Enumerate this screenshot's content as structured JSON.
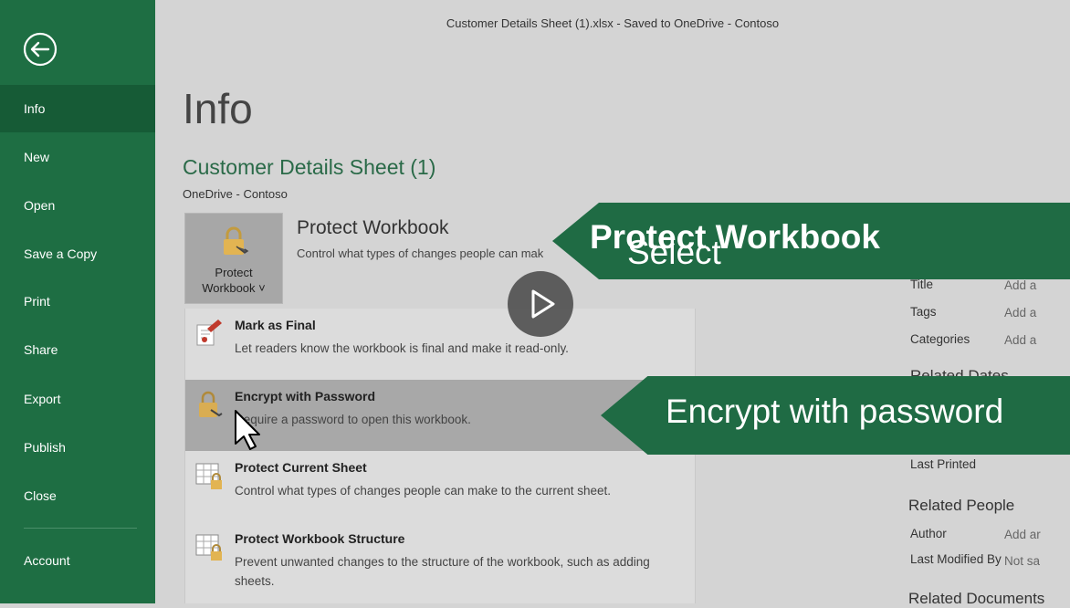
{
  "window": {
    "title": "Customer Details Sheet (1).xlsx  -  Saved to OneDrive - Contoso"
  },
  "sidebar": {
    "items": [
      {
        "label": "Info",
        "active": true
      },
      {
        "label": "New"
      },
      {
        "label": "Open"
      },
      {
        "label": "Save a Copy"
      },
      {
        "label": "Print"
      },
      {
        "label": "Share"
      },
      {
        "label": "Export"
      },
      {
        "label": "Publish"
      },
      {
        "label": "Close"
      },
      {
        "label": "Account"
      }
    ]
  },
  "page": {
    "title": "Info",
    "file_name": "Customer Details Sheet (1)",
    "file_location": "OneDrive - Contoso"
  },
  "protect": {
    "button_line1": "Protect",
    "button_line2": "Workbook ˅",
    "heading": "Protect Workbook",
    "description": "Control what types of changes people can make to this workbook."
  },
  "menu": {
    "items": [
      {
        "title": "Mark as Final",
        "desc": "Let readers know the workbook is final and make it read-only."
      },
      {
        "title": "Encrypt with Password",
        "desc": "Require a password to open this workbook.",
        "highlighted": true
      },
      {
        "title": "Protect Current Sheet",
        "desc": "Control what types of changes people can make to the current sheet."
      },
      {
        "title": "Protect Workbook Structure",
        "desc": "Prevent unwanted changes to the structure of the workbook, such as adding sheets."
      }
    ]
  },
  "properties": {
    "title_label": "Title",
    "title_value": "Add a",
    "tags_label": "Tags",
    "tags_value": "Add a",
    "categories_label": "Categories",
    "categories_value": "Add a",
    "related_dates": "Related Dates",
    "last_printed_label": "Last Printed",
    "related_people": "Related People",
    "author_label": "Author",
    "author_value": "Add ar",
    "last_modified_label": "Last Modified By",
    "last_modified_value": "Not sa",
    "related_docs": "Related Documents"
  },
  "callouts": {
    "c1_plain": "Select ",
    "c1_bold": "Protect Workbook",
    "c2": "Encrypt with password"
  },
  "colors": {
    "accent": "#1e6e43",
    "callout": "#1f6b44",
    "background": "#d4d4d4"
  }
}
